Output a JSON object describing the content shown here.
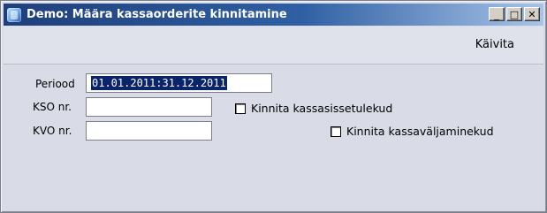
{
  "window": {
    "title": "Demo: Määra kassaorderite kinnitamine",
    "buttons": {
      "minimize": "_",
      "maximize": "□",
      "close": "✕"
    }
  },
  "menubar": {
    "run_label": "Käivita"
  },
  "form": {
    "period": {
      "label": "Periood",
      "value": "01.01.2011:31.12.2011"
    },
    "kso": {
      "label": "KSO nr.",
      "value": ""
    },
    "kvo": {
      "label": "KVO nr.",
      "value": ""
    },
    "confirm_receipts": {
      "label": "Kinnita kassasissetulekud",
      "checked": false
    },
    "confirm_payments": {
      "label": "Kinnita kassaväljaminekud",
      "checked": false
    }
  },
  "colors": {
    "titlebar_start": "#1f3f7a",
    "titlebar_end": "#a8c4e8",
    "window_bg": "#d9dce6",
    "selection_bg": "#0a246a"
  }
}
